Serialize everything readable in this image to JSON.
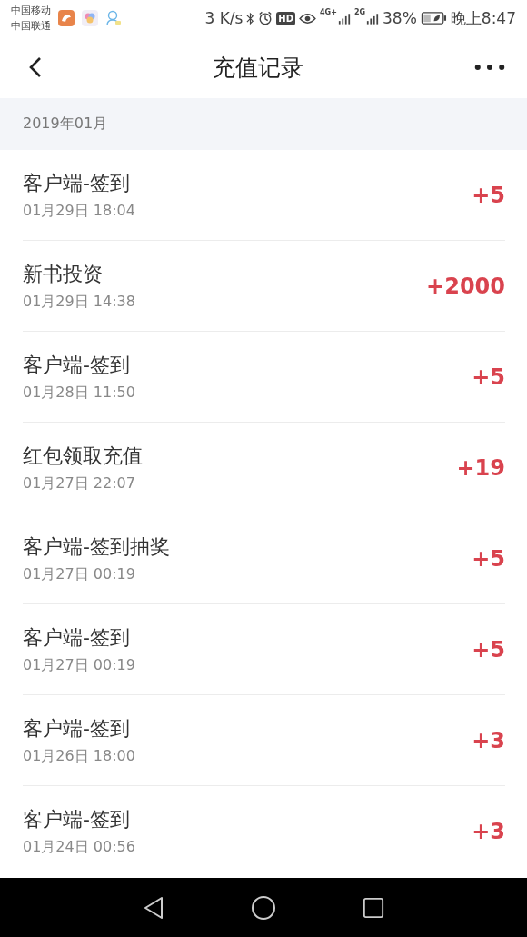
{
  "status_bar": {
    "carriers": [
      "中国移动",
      "中国联通"
    ],
    "speed": "3 K/s",
    "hd": "HD",
    "network_1": "4G+",
    "network_2": "2G",
    "battery": "38%",
    "time": "晚上8:47"
  },
  "header": {
    "title": "充值记录"
  },
  "section": {
    "label": "2019年01月"
  },
  "records": [
    {
      "title": "客户端-签到",
      "time": "01月29日 18:04",
      "amount": "+5"
    },
    {
      "title": "新书投资",
      "time": "01月29日 14:38",
      "amount": "+2000"
    },
    {
      "title": "客户端-签到",
      "time": "01月28日 11:50",
      "amount": "+5"
    },
    {
      "title": "红包领取充值",
      "time": "01月27日 22:07",
      "amount": "+19"
    },
    {
      "title": "客户端-签到抽奖",
      "time": "01月27日 00:19",
      "amount": "+5"
    },
    {
      "title": "客户端-签到",
      "time": "01月27日 00:19",
      "amount": "+5"
    },
    {
      "title": "客户端-签到",
      "time": "01月26日 18:00",
      "amount": "+3"
    },
    {
      "title": "客户端-签到",
      "time": "01月24日 00:56",
      "amount": "+3"
    }
  ]
}
